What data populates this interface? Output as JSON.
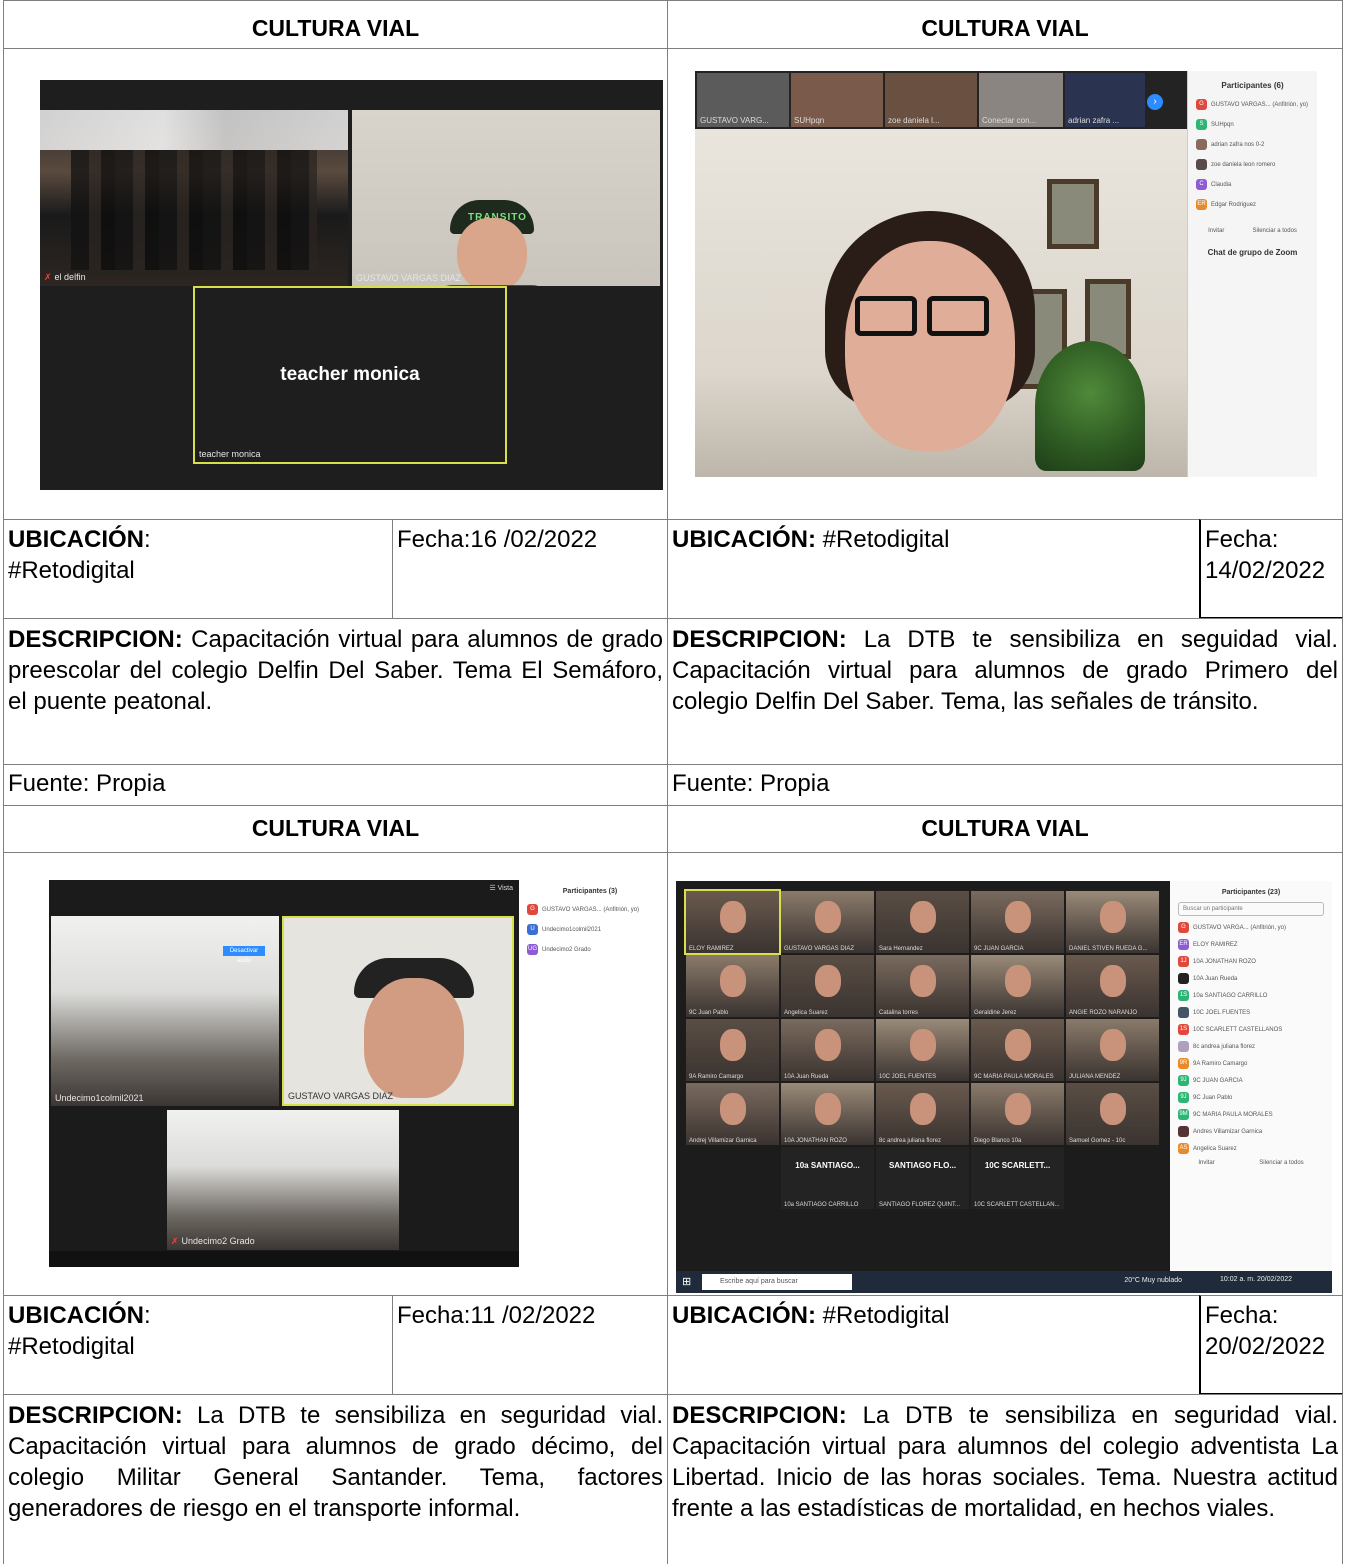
{
  "sections": [
    {
      "header": "CULTURA VIAL",
      "ubicacion_label": "UBICACIÓN",
      "ubicacion_sep": ":",
      "ubicacion_value": "#Retodigital",
      "fecha": "Fecha:16 /02/2022",
      "descripcion_label": "DESCRIPCION:",
      "descripcion_text": "Capacitación virtual para alumnos de grado preescolar del colegio Delfin Del Saber. Tema El Semáforo, el puente peatonal.",
      "fuente": "Fuente: Propia",
      "screenshot": {
        "tile_a": "el delfin",
        "tile_b": "GUSTAVO VARGAS DIAZ",
        "tile_c_center": "teacher monica",
        "tile_c_name": "teacher monica",
        "cap_text": "TRANSITO"
      }
    },
    {
      "header": "CULTURA VIAL",
      "ubicacion_label": "UBICACIÓN:",
      "ubicacion_value": "#Retodigital",
      "fecha_label": "Fecha:",
      "fecha_value": "14/02/2022",
      "descripcion_label": "DESCRIPCION:",
      "descripcion_text": "La DTB te sensibiliza en seguidad vial. Capacitación virtual para alumnos de grado Primero del colegio Delfin Del Saber. Tema, las señales de tránsito.",
      "fuente": "Fuente: Propia",
      "screenshot": {
        "strip": [
          "GUSTAVO VARG...",
          "SUHpqn",
          "zoe daniela l...",
          "Conectar con...",
          "adrian zafra ..."
        ],
        "panel_title": "Participantes (6)",
        "participants": [
          {
            "initial": "G",
            "name": "GUSTAVO VARGAS... (Anfitrión, yo)",
            "color": "#e0483c"
          },
          {
            "initial": "S",
            "name": "SUHpqn",
            "color": "#2bb673"
          },
          {
            "initial": "",
            "name": "adrian zafra nos 0-2",
            "color": "#8a6a5a"
          },
          {
            "initial": "",
            "name": "zoe daniela leon romero",
            "color": "#5a4a4a"
          },
          {
            "initial": "C",
            "name": "Claudia",
            "color": "#8e5bd6"
          },
          {
            "initial": "ER",
            "name": "Edgar Rodriguez",
            "color": "#e88a2a"
          }
        ],
        "invite": "Invitar",
        "mute_all": "Silenciar a todos",
        "chat_title": "Chat de grupo de Zoom"
      }
    },
    {
      "header": "CULTURA VIAL",
      "ubicacion_label": "UBICACIÓN",
      "ubicacion_sep": ":",
      "ubicacion_value": "#Retodigital",
      "fecha": "Fecha:11 /02/2022",
      "descripcion_label": "DESCRIPCION:",
      "descripcion_text": "La DTB te sensibiliza en seguridad vial. Capacitación virtual para alumnos de grado décimo, del colegio Militar General Santander. Tema, factores generadores de riesgo en el transporte informal.",
      "screenshot": {
        "view_label": "Vista",
        "panel_title": "Participantes (3)",
        "participants": [
          {
            "initial": "G",
            "name": "GUSTAVO VARGAS... (Anfitrión, yo)",
            "color": "#e0483c"
          },
          {
            "initial": "U",
            "name": "Undecimo1colmil2021",
            "color": "#3b6fd6"
          },
          {
            "initial": "UG",
            "name": "Undecimo2 Grado",
            "color": "#8e5bd6"
          }
        ],
        "deactivate_audio": "Desactivar audio",
        "tile_a": "Undecimo1colmil2021",
        "tile_b": "GUSTAVO VARGAS DIAZ",
        "tile_c": "Undecimo2 Grado"
      }
    },
    {
      "header": "CULTURA VIAL",
      "ubicacion_label": "UBICACIÓN:",
      "ubicacion_value": "#Retodigital",
      "fecha_label": "Fecha:",
      "fecha_value": "20/02/2022",
      "descripcion_label": "DESCRIPCION:",
      "descripcion_text": "La DTB te sensibiliza en seguridad vial. Capacitación virtual para alumnos del colegio adventista La Libertad. Inicio de las horas sociales. Tema. Nuestra actitud frente a las estadísticas de mortalidad, en hechos viales.",
      "screenshot": {
        "panel_title": "Participantes (23)",
        "search_placeholder": "Buscar un participante",
        "grid": [
          "ELOY RAMIREZ",
          "GUSTAVO VARGAS DIAZ",
          "Sara Hernandez",
          "9C JUAN GARCIA",
          "DANIEL STIVEN RUEDA G...",
          "9C Juan Pablo",
          "Angelica Suarez",
          "Catalina torres",
          "Geraldine Jerez",
          "ANGIE ROZO NARANJO",
          "9A Ramiro Camargo",
          "10A Juan Rueda",
          "10C JOEL FUENTES",
          "9C MARIA PAULA MORALES",
          "JULIANA MENDEZ",
          "Andrej Villamizar Garnica",
          "10A JONATHAN ROZO",
          "8c andrea juliana florez",
          "Diego Blanco 10a",
          "Samuel Gomez - 10c"
        ],
        "dark_tiles": [
          {
            "big": "10a SANTIAGO...",
            "name": "10a SANTIAGO CARRILLO"
          },
          {
            "big": "SANTIAGO FLO...",
            "name": "SANTIAGO FLOREZ QUINT..."
          },
          {
            "big": "10C SCARLETT...",
            "name": "10C SCARLETT CASTELLAN..."
          }
        ],
        "participants": [
          {
            "initial": "G",
            "name": "GUSTAVO VARGA... (Anfitrión, yo)",
            "color": "#e0483c"
          },
          {
            "initial": "ER",
            "name": "ELOY RAMIREZ",
            "color": "#8e5bd6"
          },
          {
            "initial": "1J",
            "name": "10A JONATHAN ROZO",
            "color": "#e0483c"
          },
          {
            "initial": "",
            "name": "10A Juan Rueda",
            "color": "#222222"
          },
          {
            "initial": "1S",
            "name": "10a SANTIAGO CARRILLO",
            "color": "#2bb673"
          },
          {
            "initial": "",
            "name": "10C JOEL FUENTES",
            "color": "#445566"
          },
          {
            "initial": "1S",
            "name": "10C SCARLETT CASTELLANOS",
            "color": "#e0483c"
          },
          {
            "initial": "",
            "name": "8c andrea juliana florez",
            "color": "#b0a0c0"
          },
          {
            "initial": "9R",
            "name": "9A Ramiro Camargo",
            "color": "#e88a2a"
          },
          {
            "initial": "9J",
            "name": "9C JUAN GARCIA",
            "color": "#2bb673"
          },
          {
            "initial": "9J",
            "name": "9C Juan Pablo",
            "color": "#2bb673"
          },
          {
            "initial": "9M",
            "name": "9C MARIA PAULA MORALES",
            "color": "#2bb673"
          },
          {
            "initial": "",
            "name": "Andres Villamizar Garnica",
            "color": "#553333"
          },
          {
            "initial": "AS",
            "name": "Angelica Suarez",
            "color": "#e88a2a"
          }
        ],
        "invite": "Invitar",
        "mute_all": "Silenciar a todos",
        "taskbar_search": "Escribe aquí para buscar",
        "weather": "20°C Muy nublado",
        "clock": "10:02 a. m. 20/02/2022"
      }
    }
  ]
}
